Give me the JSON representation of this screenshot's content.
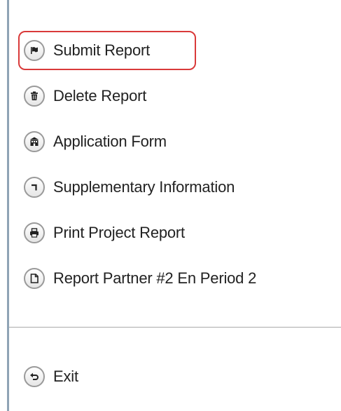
{
  "menu": {
    "items": [
      {
        "label": "Submit Report",
        "icon": "flag-icon",
        "selected": true
      },
      {
        "label": "Delete Report",
        "icon": "trash-icon"
      },
      {
        "label": "Application Form",
        "icon": "building-icon"
      },
      {
        "label": "Supplementary Information",
        "icon": "corner-arrow-icon"
      },
      {
        "label": "Print Project Report",
        "icon": "printer-icon"
      },
      {
        "label": "Report Partner #2 En Period 2",
        "icon": "document-icon"
      }
    ],
    "exit": {
      "label": "Exit",
      "icon": "undo-arrow-icon"
    }
  },
  "colors": {
    "selection_border": "#d93a3a",
    "left_rule": "#8fa3b5",
    "separator": "#a9a9a9"
  }
}
